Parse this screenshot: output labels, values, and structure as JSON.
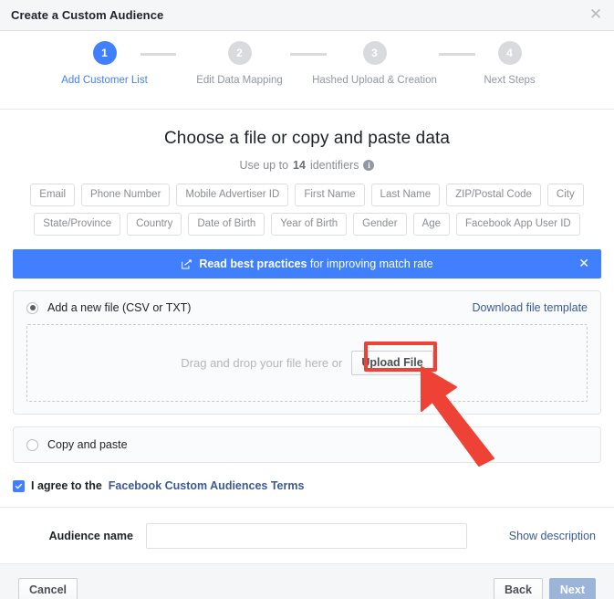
{
  "window": {
    "title": "Create a Custom Audience",
    "close_icon": "close-icon",
    "close_glyph": "✕"
  },
  "stepper": {
    "steps": [
      {
        "number": "1",
        "label": "Add Customer List",
        "active": true
      },
      {
        "number": "2",
        "label": "Edit Data Mapping",
        "active": false
      },
      {
        "number": "3",
        "label": "Hashed Upload & Creation",
        "active": false
      },
      {
        "number": "4",
        "label": "Next Steps",
        "active": false
      }
    ]
  },
  "main": {
    "heading": "Choose a file or copy and paste data",
    "subheading_prefix": "Use up to ",
    "subheading_count": "14",
    "subheading_suffix": " identifiers",
    "info_icon": "info-icon",
    "info_glyph": "i",
    "identifiers": [
      "Email",
      "Phone Number",
      "Mobile Advertiser ID",
      "First Name",
      "Last Name",
      "ZIP/Postal Code",
      "City",
      "State/Province",
      "Country",
      "Date of Birth",
      "Year of Birth",
      "Gender",
      "Age",
      "Facebook App User ID"
    ]
  },
  "banner": {
    "icon": "external-link-icon",
    "strong_text": "Read best practices",
    "rest_text": " for improving match rate",
    "close_glyph": "✕",
    "color": "#4080ff"
  },
  "file_option": {
    "radio_label": "Add a new file (CSV or TXT)",
    "selected": true,
    "download_link": "Download file template",
    "dropzone_text": "Drag and drop your file here or",
    "upload_button": "Upload File"
  },
  "paste_option": {
    "radio_label": "Copy and paste",
    "selected": false
  },
  "terms": {
    "checked": true,
    "text": "I agree to the ",
    "link": "Facebook Custom Audiences Terms"
  },
  "audience": {
    "label": "Audience name",
    "value": "",
    "placeholder": "",
    "show_description": "Show description"
  },
  "footer": {
    "cancel": "Cancel",
    "back": "Back",
    "next": "Next",
    "next_disabled": true
  },
  "annotation": {
    "color": "#ef4236",
    "target": "Upload File"
  }
}
